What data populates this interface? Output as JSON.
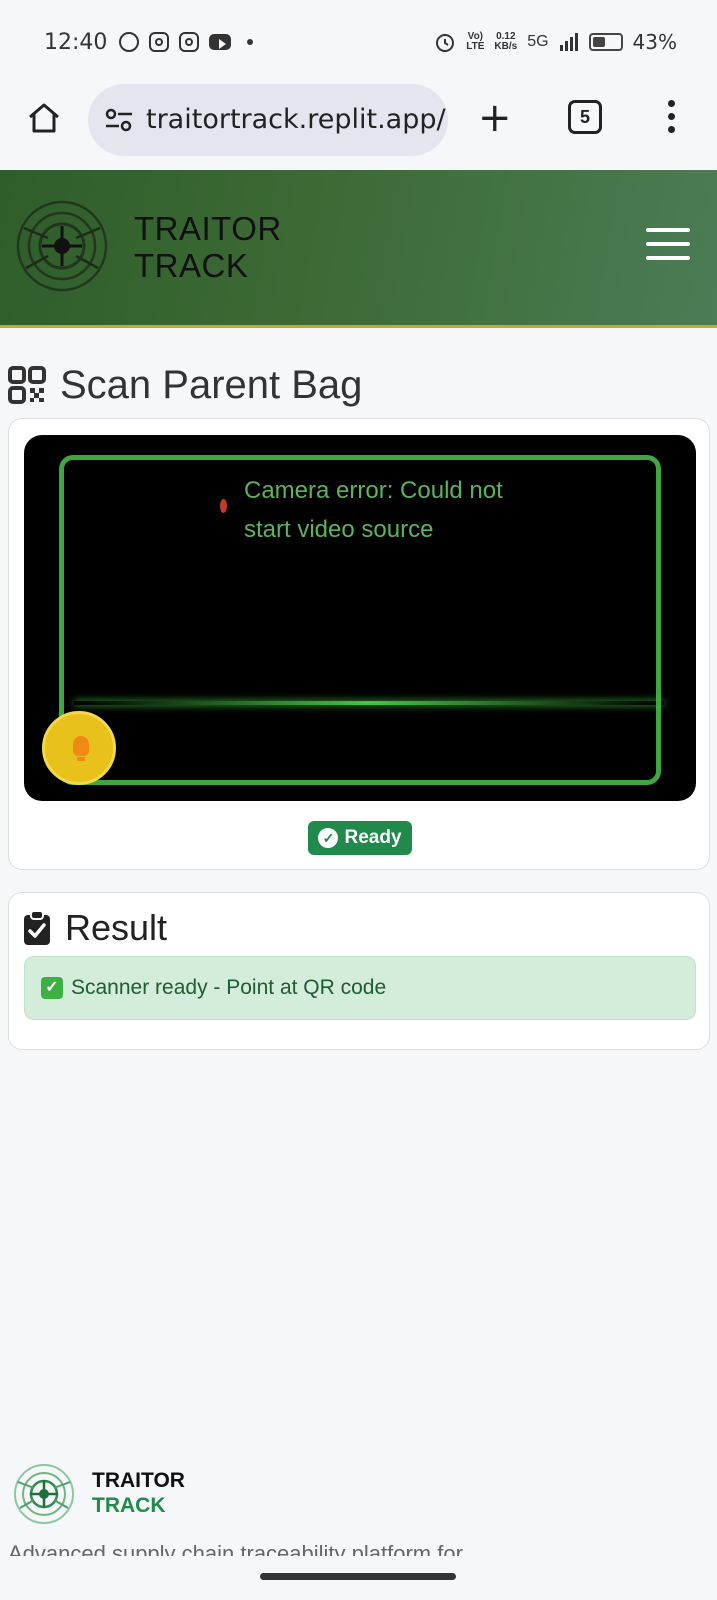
{
  "status_bar": {
    "time": "12:40",
    "network_label_1": "Vo)",
    "network_label_2": "LTE",
    "speed_value": "0.12",
    "speed_unit": "KB/s",
    "signal": "5G",
    "battery_percent": "43%"
  },
  "browser": {
    "url": "traitortrack.replit.app/",
    "tab_count": "5"
  },
  "header": {
    "brand_line1": "TRAITOR",
    "brand_line2": "TRACK"
  },
  "page": {
    "title": "Scan Parent Bag"
  },
  "scanner": {
    "error_text": "Camera error: Could not start video source",
    "status_badge": "Ready",
    "accent_color": "#3fa640"
  },
  "result": {
    "title": "Result",
    "message": "Scanner ready - Point at QR code",
    "check_glyph": "✓"
  },
  "footer": {
    "brand_line1": "TRAITOR",
    "brand_line2": "TRACK",
    "description": "Advanced supply chain traceability platform for"
  },
  "icons": [
    "whatsapp-icon",
    "instagram-icon",
    "instagram-icon",
    "youtube-icon",
    "alarm-icon",
    "signal-icon",
    "battery-icon",
    "home-icon",
    "site-settings-icon",
    "new-tab-icon",
    "tabs-icon",
    "more-menu-icon",
    "logo-icon",
    "hamburger-icon",
    "qr-code-icon",
    "torch-icon",
    "check-circle-icon",
    "clipboard-check-icon"
  ]
}
